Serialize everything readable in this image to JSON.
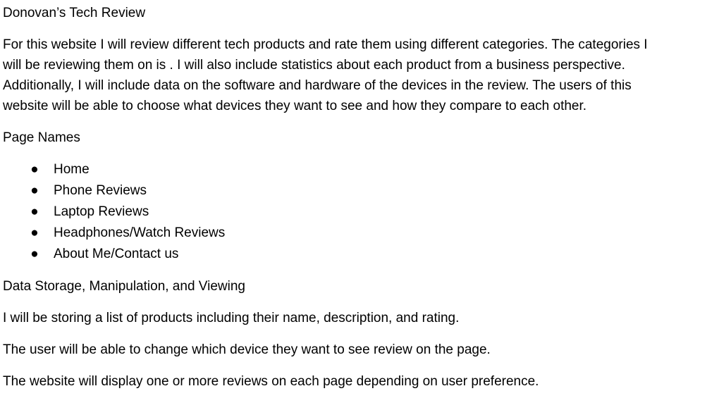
{
  "document": {
    "title": "Donovan’s Tech Review",
    "intro": "For this website I will review different tech products and rate them using different categories. The categories I will be reviewing them on is . I will also include statistics about each product from a business perspective. Additionally, I will include data on the software and hardware of the devices in the review. The users of this website will be able to choose what devices they want to see and how they compare to each other.",
    "page_names_heading": "Page Names",
    "bullet_glyph": "●",
    "pages": [
      {
        "label": "Home"
      },
      {
        "label": "Phone Reviews"
      },
      {
        "label": "Laptop Reviews"
      },
      {
        "label": "Headphones/Watch Reviews"
      },
      {
        "label": "About Me/Contact us"
      }
    ],
    "data_heading": "Data Storage, Manipulation, and Viewing",
    "data_paragraphs": [
      "I will be storing a list of products including their name, description, and rating.",
      "The user will be able to change which device they want to see review on the page.",
      "The website will display one or more reviews on each page depending on user preference."
    ]
  }
}
